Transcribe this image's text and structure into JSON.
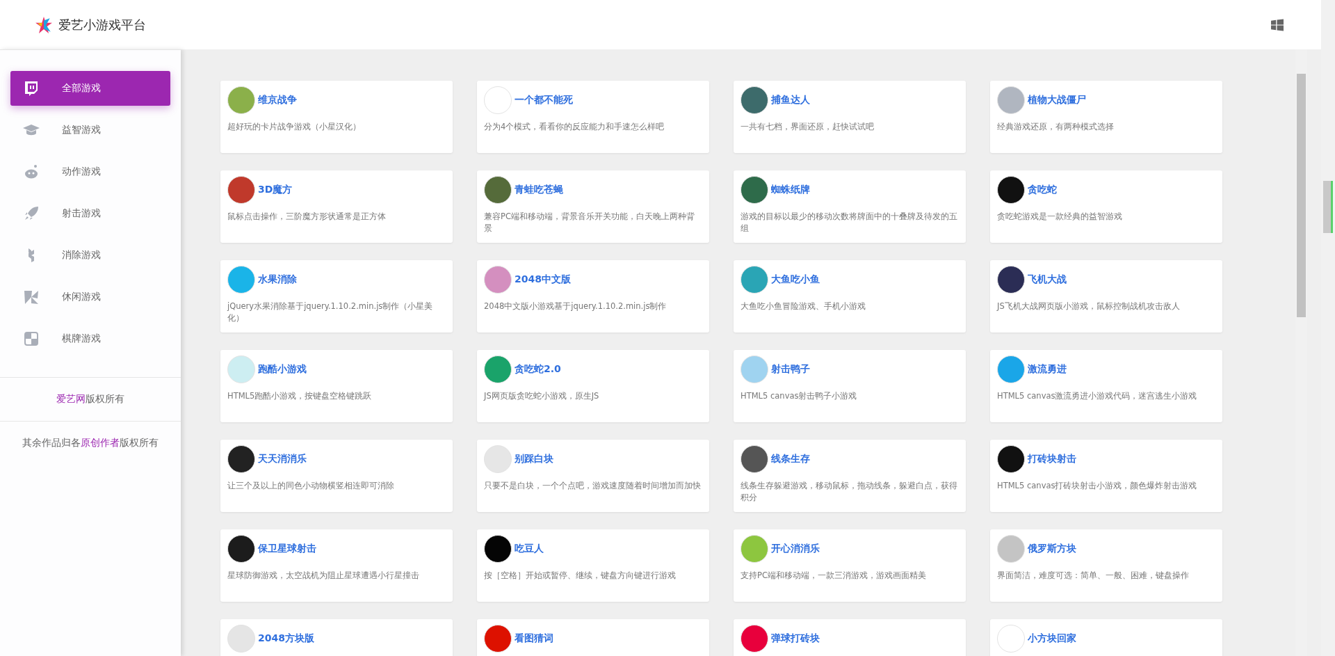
{
  "header": {
    "title": "爱艺小游戏平台"
  },
  "sidebar": {
    "items": [
      {
        "label": "全部游戏",
        "selected": true
      },
      {
        "label": "益智游戏",
        "selected": false
      },
      {
        "label": "动作游戏",
        "selected": false
      },
      {
        "label": "射击游戏",
        "selected": false
      },
      {
        "label": "消除游戏",
        "selected": false
      },
      {
        "label": "休闲游戏",
        "selected": false
      },
      {
        "label": "棋牌游戏",
        "selected": false
      }
    ],
    "footer": [
      [
        {
          "text": "爱艺网",
          "link": true
        },
        {
          "text": "版权所有",
          "link": false
        }
      ],
      [
        {
          "text": "其余作品归各",
          "link": false
        },
        {
          "text": "原创作者",
          "link": true
        },
        {
          "text": "版权所有",
          "link": false
        }
      ]
    ]
  },
  "games": [
    {
      "title": "维京战争",
      "description": "超好玩的卡片战争游戏（小星汉化）"
    },
    {
      "title": "一个都不能死",
      "description": "分为4个模式，看看你的反应能力和手速怎么样吧"
    },
    {
      "title": "捕鱼达人",
      "description": "一共有七档，界面还原，赶快试试吧"
    },
    {
      "title": "植物大战僵尸",
      "description": "经典游戏还原，有两种模式选择"
    },
    {
      "title": "3D魔方",
      "description": "鼠标点击操作，三阶魔方形状通常是正方体"
    },
    {
      "title": "青蛙吃苍蝇",
      "description": "兼容PC端和移动端，背景音乐开关功能，白天晚上两种背景"
    },
    {
      "title": "蜘蛛纸牌",
      "description": "游戏的目标以最少的移动次数将牌面中的十叠牌及待发的五组"
    },
    {
      "title": "贪吃蛇",
      "description": "贪吃蛇游戏是一款经典的益智游戏"
    },
    {
      "title": "水果消除",
      "description": "jQuery水果消除基于jquery.1.10.2.min.js制作（小星美化）"
    },
    {
      "title": "2048中文版",
      "description": "2048中文版小游戏基于jquery.1.10.2.min.js制作"
    },
    {
      "title": "大鱼吃小鱼",
      "description": "大鱼吃小鱼冒险游戏、手机小游戏"
    },
    {
      "title": "飞机大战",
      "description": "JS飞机大战网页版小游戏，鼠标控制战机攻击敌人"
    },
    {
      "title": "跑酷小游戏",
      "description": "HTML5跑酷小游戏，按键盘空格键跳跃"
    },
    {
      "title": "贪吃蛇2.0",
      "description": "JS网页版贪吃蛇小游戏，原生JS"
    },
    {
      "title": "射击鸭子",
      "description": "HTML5 canvas射击鸭子小游戏"
    },
    {
      "title": "激流勇进",
      "description": "HTML5 canvas激流勇进小游戏代码，迷宫逃生小游戏"
    },
    {
      "title": "天天消消乐",
      "description": "让三个及以上的同色小动物横竖相连即可消除"
    },
    {
      "title": "别踩白块",
      "description": "只要不是白块，一个个点吧，游戏速度随着时间增加而加快"
    },
    {
      "title": "线条生存",
      "description": "线条生存躲避游戏，移动鼠标，拖动线条，躲避白点，获得积分"
    },
    {
      "title": "打砖块射击",
      "description": "HTML5 canvas打砖块射击小游戏，颜色爆炸射击游戏"
    },
    {
      "title": "保卫星球射击",
      "description": "星球防御游戏，太空战机为阻止星球遭遇小行星撞击"
    },
    {
      "title": "吃豆人",
      "description": "按［空格］开始或暂停、继续，键盘方向键进行游戏"
    },
    {
      "title": "开心消消乐",
      "description": "支持PC端和移动端，一款三消游戏，游戏画面精美"
    },
    {
      "title": "俄罗斯方块",
      "description": "界面简洁，难度可选：简单、一般、困难，键盘操作"
    },
    {
      "title": "2048方块版"
    },
    {
      "title": "看图猜词"
    },
    {
      "title": "弹球打砖块"
    },
    {
      "title": "小方块回家"
    }
  ]
}
